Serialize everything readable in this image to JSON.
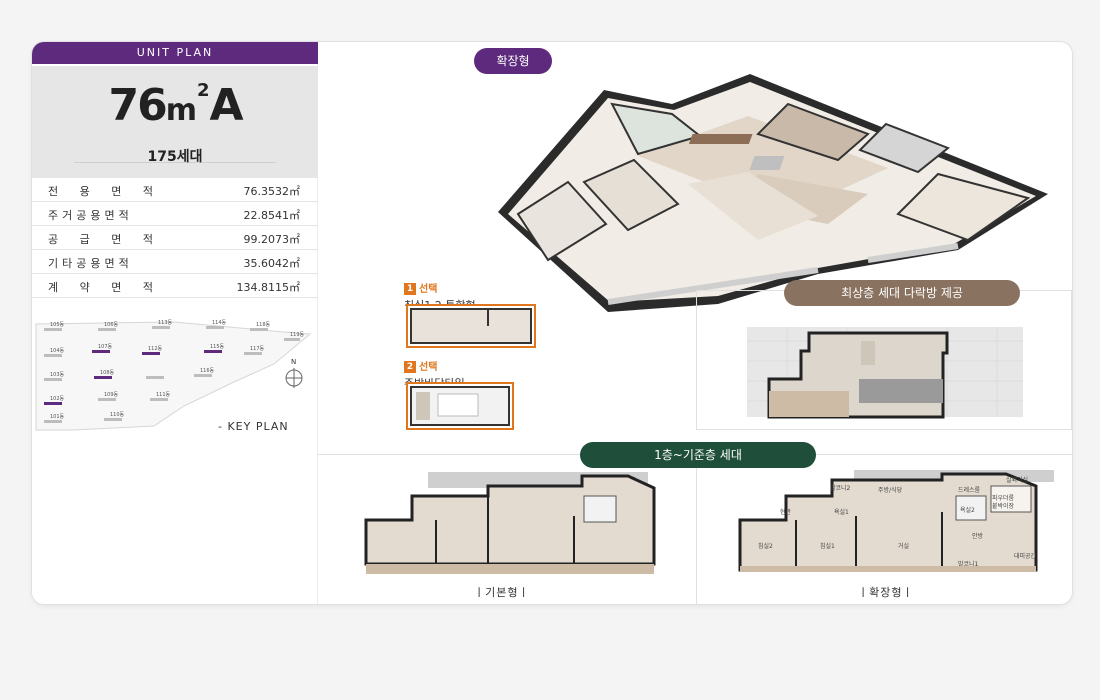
{
  "header": {
    "unit_plan": "UNIT PLAN"
  },
  "unit": {
    "size_number": "76",
    "size_unit": "m",
    "size_sup": "2",
    "size_type": "A",
    "households": "175세대"
  },
  "specs": [
    {
      "label": "전 용 면 적",
      "value": "76.3532㎡"
    },
    {
      "label": "주거공용면적",
      "value": "22.8541㎡"
    },
    {
      "label": "공 급 면 적",
      "value": "99.2073㎡"
    },
    {
      "label": "기타공용면적",
      "value": "35.6042㎡"
    },
    {
      "label": "계 약 면 적",
      "value": "134.8115㎡"
    }
  ],
  "key_plan": {
    "label": "- KEY PLAN",
    "north": "N",
    "buildings": [
      "105동",
      "106동",
      "113동",
      "114동",
      "118동",
      "119동",
      "104동",
      "107동",
      "112동",
      "115동",
      "117동",
      "103동",
      "108동",
      "116동",
      "102동",
      "109동",
      "111동",
      "101동",
      "110동"
    ]
  },
  "main": {
    "expanded_pill": "확장형",
    "option1": {
      "num": "1",
      "sel": "선택",
      "title": "침실1,2 통합형"
    },
    "option2": {
      "num": "2",
      "sel": "선택",
      "title": "주방바닥타일"
    },
    "penthouse_pill": "최상층 세대 다락방 제공",
    "floors_pill": "1층~기준층 세대",
    "basic_caption": "ㅣ기본형ㅣ",
    "expanded_caption": "ㅣ확장형ㅣ",
    "room_labels": [
      "발코니2",
      "주방/식당",
      "드레스룸",
      "실외기실",
      "현관",
      "욕실1",
      "욕실2",
      "파우더룸",
      "붙박이장",
      "침실2",
      "침실1",
      "거실",
      "안방",
      "발코니1",
      "대피공간"
    ]
  },
  "colors": {
    "purple": "#5e2a7e",
    "brown": "#8a7260",
    "green": "#1f4f3a",
    "orange": "#e0761e"
  }
}
